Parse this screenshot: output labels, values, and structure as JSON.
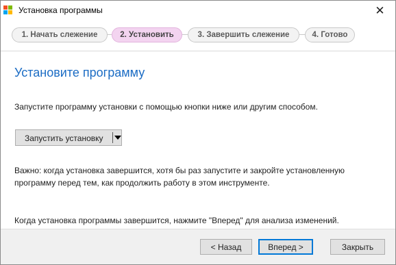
{
  "window": {
    "title": "Установка программы",
    "close_glyph": "✕",
    "icon": "windows-logo-icon",
    "icon_colors": [
      "#f25022",
      "#7fba00",
      "#00a4ef",
      "#ffb900"
    ]
  },
  "steps": [
    {
      "label": "1. Начать слежение",
      "active": false
    },
    {
      "label": "2. Установить",
      "active": true
    },
    {
      "label": "3. Завершить слежение",
      "active": false
    },
    {
      "label": "4. Готово",
      "active": false
    }
  ],
  "main": {
    "heading": "Установите программу",
    "instruction": "Запустите программу установки с помощью кнопки ниже или другим способом.",
    "run_button_label": "Запустить установку",
    "important_note": "Важно: когда установка завершится, хотя бы раз запустите и закройте установленную программу перед тем, как продолжить работу в этом инструменте.",
    "final_note": "Когда установка программы завершится, нажмите \"Вперед\" для анализа изменений."
  },
  "footer": {
    "back_label": "< Назад",
    "next_label": "Вперед >",
    "close_label": "Закрыть"
  },
  "colors": {
    "accent": "#1b6cc4",
    "active_step_bg": "#f3d4f0",
    "primary_border": "#0078d7"
  }
}
